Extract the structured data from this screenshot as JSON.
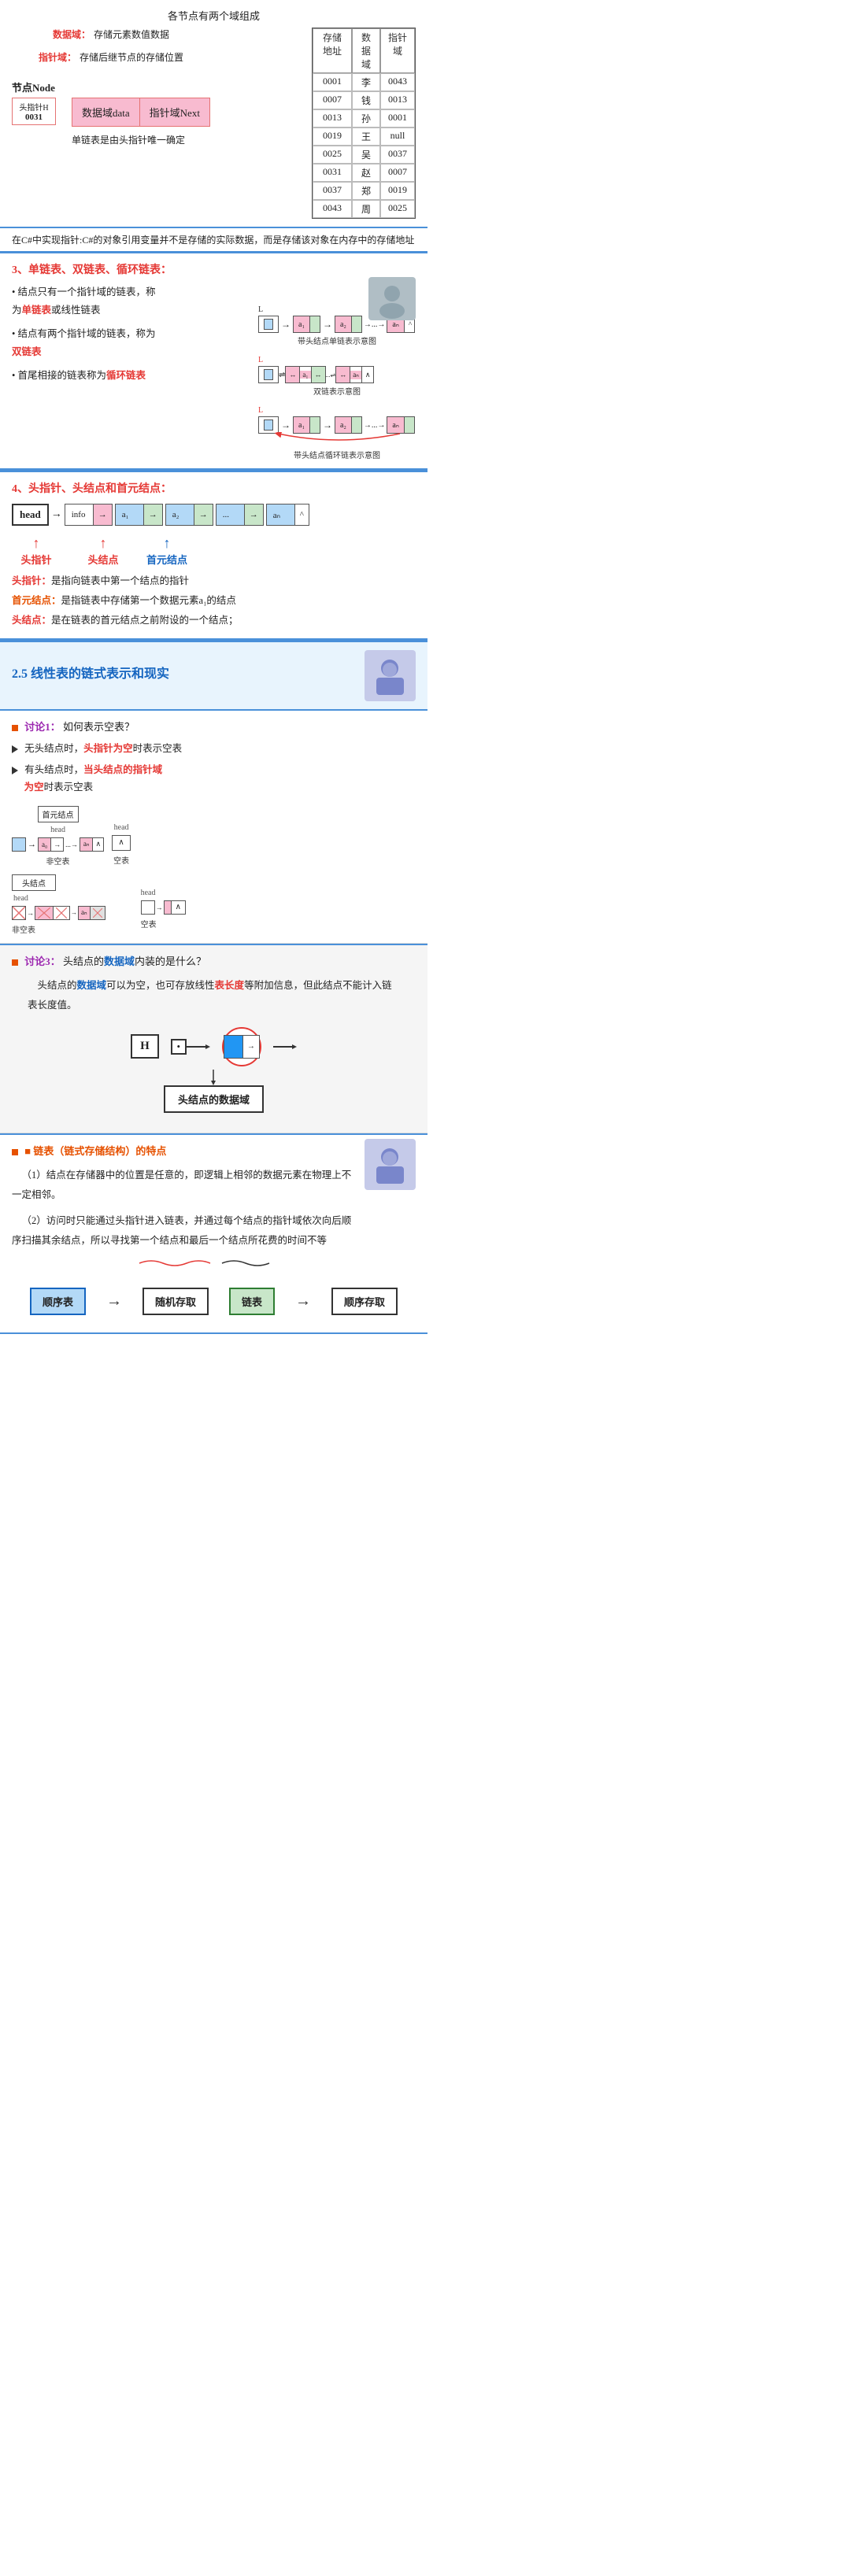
{
  "section1": {
    "title": "各节点有两个域组成",
    "field_data_label": "数据域：",
    "field_data_desc": "存储元素数值数据",
    "field_ptr_label": "指针域：",
    "field_ptr_desc": "存储后继节点的存储位置",
    "node_label": "节点Node",
    "head_ptr_label": "头指针H",
    "head_ptr_value": "0031",
    "node_data_box": "数据域data",
    "node_next_box": "指针域Next",
    "single_link_note": "单链表是由头指针唯一确定",
    "memory_table": {
      "headers": [
        "存储地址",
        "数据域",
        "指针域"
      ],
      "rows": [
        [
          "0001",
          "李",
          "0043"
        ],
        [
          "0007",
          "钱",
          "0013"
        ],
        [
          "0013",
          "孙",
          "0001"
        ],
        [
          "0019",
          "王",
          "null"
        ],
        [
          "0025",
          "吴",
          "0037"
        ],
        [
          "0031",
          "赵",
          "0007"
        ],
        [
          "0037",
          "郑",
          "0019"
        ],
        [
          "0043",
          "周",
          "0025"
        ]
      ]
    }
  },
  "note1": {
    "text": "在C#中实现指针:C#的对象引用变量并不是存储的实际数据，而是存储该对象在内存中的存储地址"
  },
  "section3": {
    "heading": "3、单链表、双链表、循环链表：",
    "bullets": [
      {
        "text_before": "结点只有一个指针域的链表，称为",
        "highlight": "单链表",
        "text_after": "或线性链表"
      },
      {
        "text_before": "结点有两个指针域的链表，称为",
        "highlight": "双链表"
      },
      {
        "text_before": "首尾相接的链表称为",
        "highlight": "循环链表"
      }
    ],
    "diagram1_label": "带头结点单链表示意图",
    "diagram2_label": "双链表示意图",
    "diagram3_label": "带头结点循环链表示意图"
  },
  "section4": {
    "heading": "4、头指针、头结点和首元结点：",
    "head_label": "head",
    "node_info": "info",
    "node_a1": "a₁",
    "node_a2": "a₂",
    "node_dots": "...",
    "node_an": "aₙ",
    "node_end": "^",
    "label_head_ptr": "头指针",
    "label_head_node": "头结点",
    "label_first_node": "首元结点",
    "def_head_ptr": "头指针：是指向链表中第一个结点的指针",
    "def_first_node": "首元结点：是指链表中存储第一个数据元素a₁的结点",
    "def_head_node": "头结点：是在链表的首元结点之前附设的一个结点；"
  },
  "section25": {
    "heading": "2.5 线性表的链式表示和现实"
  },
  "discussion1": {
    "label": "讨论1：",
    "question": "如何表示空表？",
    "bullet1_prefix": "无头结点时，",
    "bullet1_highlight": "头指针为空",
    "bullet1_suffix": "时表示空表",
    "bullet2_prefix": "有头结点时，",
    "bullet2_highlight": "当头结点的指针域为空",
    "bullet2_suffix": "时表示空表",
    "head_label": "head",
    "first_node_label": "首元结点",
    "non_empty_label": "非空表",
    "empty_label": "空表",
    "head_node_label": "头结点"
  },
  "discussion3": {
    "label": "讨论3：",
    "question": "头结点的数据域内装的是什么？",
    "body1": "头结点的",
    "body1_hl": "数据域",
    "body2": "可以为空，也可存放线性",
    "body2_hl": "表长度",
    "body3": "等附加信息，但此结点不能计入链表长度值。",
    "h_label": "H",
    "diagram_label": "头结点的数据域"
  },
  "section_chain": {
    "heading": "■ 链表（链式存储结构）的特点",
    "point1_prefix": "（1）结点在存储器中的位置是任意的，即逻辑上相邻的数据元素在物理上不一定相邻。",
    "point2_prefix": "（2）访问时只能通过头指针进入链表，并通过每个结点的指针域依次向后顺序扫描其余结点，所以寻找第一个结点和最后一个结点所花费的时间不等"
  },
  "comparison": {
    "box1": "顺序表",
    "arrow1": "→",
    "box2": "随机存取",
    "box3": "链表",
    "arrow2": "→",
    "box4": "顺序存取"
  }
}
